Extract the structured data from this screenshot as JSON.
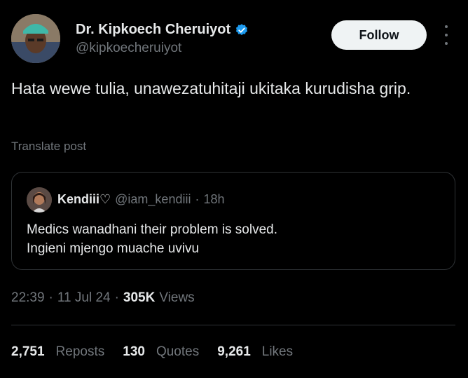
{
  "author": {
    "name": "Dr. Kipkoech Cheruiyot",
    "handle": "@kipkoecheruiyot",
    "verified_color": "#1d9bf0"
  },
  "follow_label": "Follow",
  "post": {
    "text": "Hata wewe tulia, unawezatuhitaji ukitaka kurudisha grip.",
    "translate_label": "Translate post"
  },
  "quote": {
    "name": "Kendiii♡",
    "handle": "@iam_kendiii",
    "separator": "·",
    "time": "18h",
    "line1": "Medics wanadhani their problem is solved.",
    "line2": "Ingieni mjengo muache uvivu"
  },
  "meta": {
    "time": "22:39",
    "sep1": "·",
    "date": "11 Jul 24",
    "sep2": "·",
    "views_count": "305K",
    "views_label": "Views"
  },
  "stats": {
    "reposts_count": "2,751",
    "reposts_label": "Reposts",
    "quotes_count": "130",
    "quotes_label": "Quotes",
    "likes_count": "9,261",
    "likes_label": "Likes"
  },
  "colors": {
    "background": "#000000",
    "text_primary": "#e7e9ea",
    "text_secondary": "#71767b",
    "border": "#2f3336",
    "follow_bg": "#eff3f4"
  }
}
